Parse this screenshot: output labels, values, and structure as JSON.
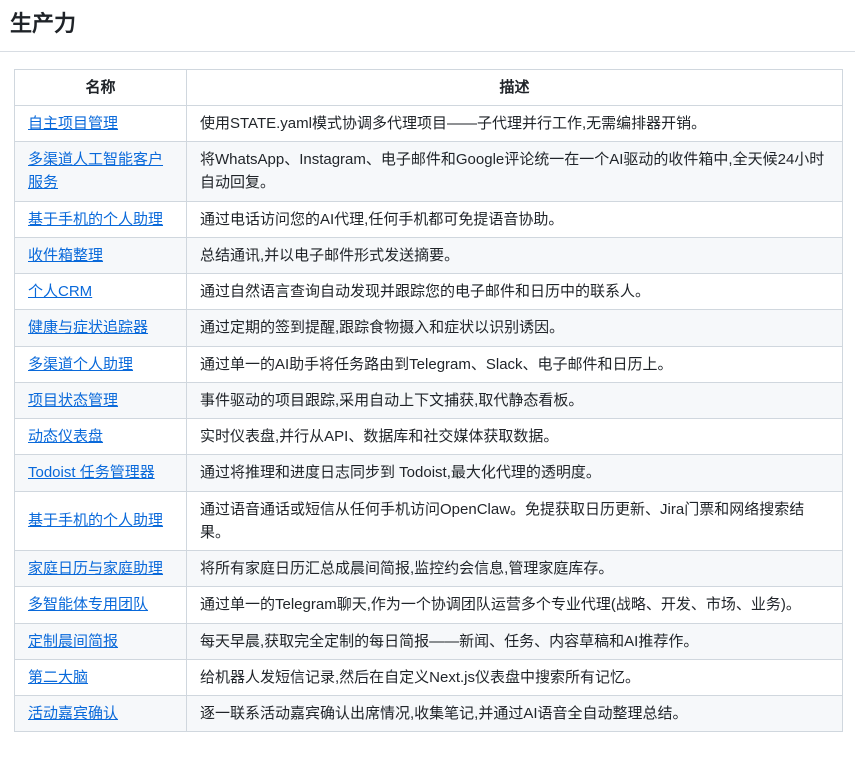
{
  "page": {
    "title": "生产力"
  },
  "colors": {
    "link": "#0969da",
    "border": "#d0d7de",
    "row_stripe": "#f6f8fa",
    "text": "#1f2328"
  },
  "table": {
    "headers": {
      "name": "名称",
      "description": "描述"
    },
    "rows": [
      {
        "name": "自主项目管理",
        "description": "使用STATE.yaml模式协调多代理项目——子代理并行工作,无需编排器开销。"
      },
      {
        "name": "多渠道人工智能客户服务",
        "description": "将WhatsApp、Instagram、电子邮件和Google评论统一在一个AI驱动的收件箱中,全天候24小时自动回复。"
      },
      {
        "name": "基于手机的个人助理",
        "description": "通过电话访问您的AI代理,任何手机都可免提语音协助。"
      },
      {
        "name": "收件箱整理",
        "description": "总结通讯,并以电子邮件形式发送摘要。"
      },
      {
        "name": "个人CRM",
        "description": "通过自然语言查询自动发现并跟踪您的电子邮件和日历中的联系人。"
      },
      {
        "name": "健康与症状追踪器",
        "description": "通过定期的签到提醒,跟踪食物摄入和症状以识别诱因。"
      },
      {
        "name": "多渠道个人助理",
        "description": "通过单一的AI助手将任务路由到Telegram、Slack、电子邮件和日历上。"
      },
      {
        "name": "项目状态管理",
        "description": "事件驱动的项目跟踪,采用自动上下文捕获,取代静态看板。"
      },
      {
        "name": "动态仪表盘",
        "description": "实时仪表盘,并行从API、数据库和社交媒体获取数据。"
      },
      {
        "name": "Todoist 任务管理器",
        "description": "通过将推理和进度日志同步到 Todoist,最大化代理的透明度。"
      },
      {
        "name": "基于手机的个人助理",
        "description": "通过语音通话或短信从任何手机访问OpenClaw。免提获取日历更新、Jira门票和网络搜索结果。"
      },
      {
        "name": "家庭日历与家庭助理",
        "description": "将所有家庭日历汇总成晨间简报,监控约会信息,管理家庭库存。"
      },
      {
        "name": "多智能体专用团队",
        "description": "通过单一的Telegram聊天,作为一个协调团队运营多个专业代理(战略、开发、市场、业务)。"
      },
      {
        "name": "定制晨间简报",
        "description": "每天早晨,获取完全定制的每日简报——新闻、任务、内容草稿和AI推荐作。"
      },
      {
        "name": "第二大脑",
        "description": "给机器人发短信记录,然后在自定义Next.js仪表盘中搜索所有记忆。"
      },
      {
        "name": "活动嘉宾确认",
        "description": "逐一联系活动嘉宾确认出席情况,收集笔记,并通过AI语音全自动整理总结。"
      }
    ]
  }
}
